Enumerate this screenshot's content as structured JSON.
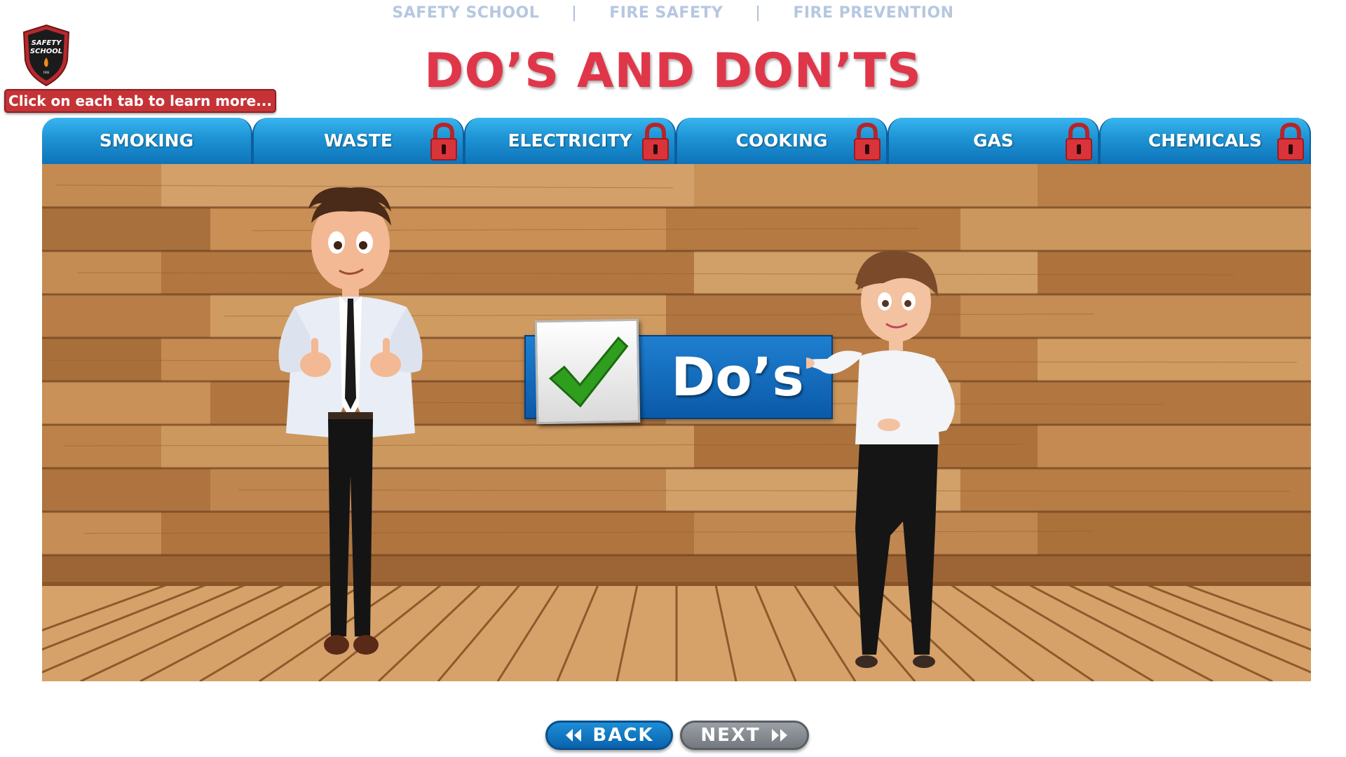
{
  "breadcrumb": {
    "items": [
      "SAFETY SCHOOL",
      "FIRE SAFETY",
      "FIRE PREVENTION"
    ],
    "separator": "|"
  },
  "logo": {
    "line1": "SAFETY",
    "line2": "SCHOOL",
    "line3": "FIRE"
  },
  "hint": "Click on each tab to learn more...",
  "title": "DO’S AND DON’TS",
  "tabs": [
    {
      "label": "SMOKING",
      "locked": false
    },
    {
      "label": "WASTE",
      "locked": true
    },
    {
      "label": "ELECTRICITY",
      "locked": true
    },
    {
      "label": "COOKING",
      "locked": true
    },
    {
      "label": "GAS",
      "locked": true
    },
    {
      "label": "CHEMICALS",
      "locked": true
    }
  ],
  "scene": {
    "sign_label": "Do’s",
    "sign_icon": "checkmark-icon"
  },
  "nav": {
    "back": "BACK",
    "next": "NEXT"
  },
  "colors": {
    "title": "#e0364a",
    "tab": "#1d93d3",
    "lock": "#d8343a",
    "back_button": "#0a62ad",
    "next_button": "#7d8288",
    "check": "#2f9e1f"
  }
}
